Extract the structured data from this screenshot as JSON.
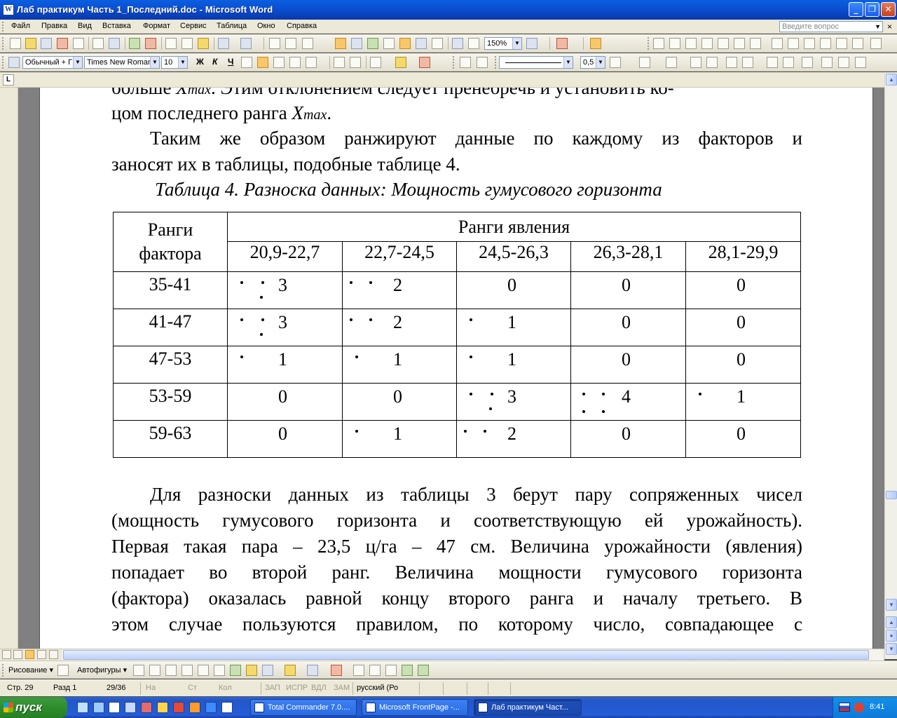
{
  "window": {
    "title": "Лаб практикум Часть 1_Последний.doc - Microsoft Word",
    "app_icon": "word-icon",
    "minimize": "_",
    "maximize": "❐",
    "close": "✕"
  },
  "menu": {
    "items": [
      "Файл",
      "Правка",
      "Вид",
      "Вставка",
      "Формат",
      "Сервис",
      "Таблица",
      "Окно",
      "Справка"
    ],
    "help_placeholder": "Введите вопрос",
    "doc_close": "×"
  },
  "toolbar": {
    "zoom": "150%",
    "style": "Обычный + Г",
    "font": "Times New Roman",
    "size": "10",
    "bold": "Ж",
    "italic": "К",
    "underline": "Ч",
    "line_width": "0,5"
  },
  "document": {
    "line1_a": "больше ",
    "line1_var": "X",
    "line1_sub": "max",
    "line1_b": ". Этим отклонением следует пренебречь и установить ко-",
    "line2_a": "цом последнего ранга ",
    "line2_var": "X",
    "line2_sub": "max",
    "line2_b": ".",
    "p1_line1": "Таким же образом ранжируют данные по каждому из факторов и",
    "p1_line2": "заносят их в таблицы, подобные таблице 4.",
    "caption": "Таблица 4. Разноска данных: Мощность гумусового горизонта",
    "p2_lines": [
      "Для разноски данных из таблицы 3 берут пару сопряженных чисел",
      "(мощность гумусового горизонта и соответствующую ей урожайность).",
      "Первая такая пара – 23,5 ц/га – 47 см. Величина урожайности (явления)",
      "попадает во второй ранг. Величина мощности гумусового горизонта",
      "(фактора) оказалась равной концу второго ранга и началу третьего. В",
      "этом случае пользуются правилом, по которому число, совпадающее с"
    ]
  },
  "table": {
    "factor_header": "Ранги фактора",
    "factor_header_l1": "Ранги",
    "factor_header_l2": "фактора",
    "phenomenon_header": "Ранги явления",
    "columns": [
      "20,9-22,7",
      "22,7-24,5",
      "24,5-26,3",
      "26,3-28,1",
      "28,1-29,9"
    ],
    "rows": [
      {
        "label": "35-41",
        "values": [
          "3",
          "2",
          "0",
          "0",
          "0"
        ]
      },
      {
        "label": "41-47",
        "values": [
          "3",
          "2",
          "1",
          "0",
          "0"
        ]
      },
      {
        "label": "47-53",
        "values": [
          "1",
          "1",
          "1",
          "0",
          "0"
        ]
      },
      {
        "label": "53-59",
        "values": [
          "0",
          "0",
          "3",
          "4",
          "1"
        ]
      },
      {
        "label": "59-63",
        "values": [
          "0",
          "1",
          "2",
          "0",
          "0"
        ]
      }
    ]
  },
  "drawing_toolbar": {
    "draw": "Рисование ▾",
    "autoshapes": "Автофигуры ▾"
  },
  "status": {
    "page": "Стр.  29",
    "section": "Разд  1",
    "pages": "29/36",
    "at": "На",
    "line": "Ст",
    "col": "Кол",
    "rec": "ЗАП",
    "trk": "ИСПР",
    "ext": "ВДЛ",
    "ovr": "ЗАМ",
    "lang": "русский (Ро"
  },
  "taskbar": {
    "start": "пуск",
    "tasks": [
      "Total Commander 7.0....",
      "Microsoft FrontPage -...",
      "Лаб практикум Част..."
    ],
    "clock": "8:41"
  }
}
